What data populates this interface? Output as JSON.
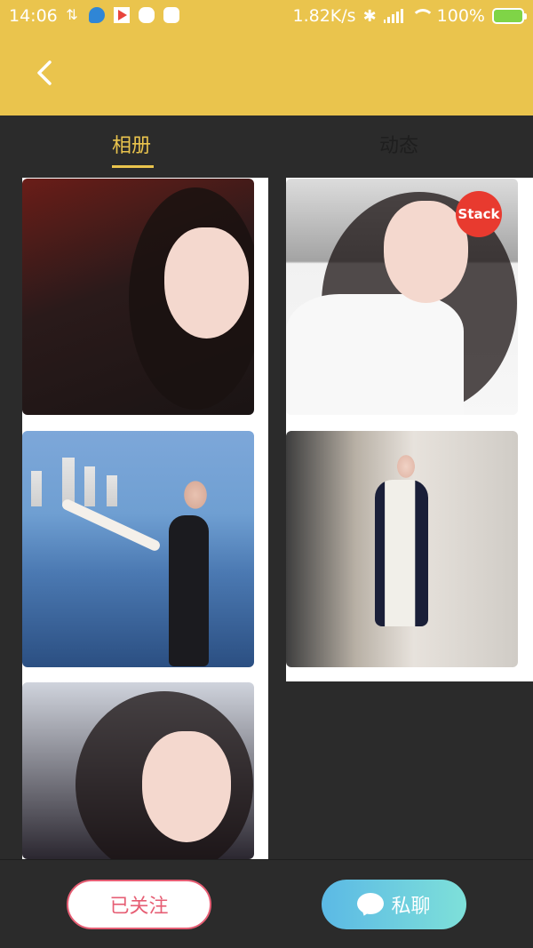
{
  "status_bar": {
    "time": "14:06",
    "speed": "1.82K/s",
    "battery": "100%"
  },
  "header": {
    "back_icon": "chevron-left-icon"
  },
  "tabs": [
    {
      "label": "相册",
      "active": true
    },
    {
      "label": "动态",
      "active": false
    }
  ],
  "photos": [
    {
      "name": "photo-1"
    },
    {
      "name": "photo-2",
      "badge": "Stack"
    },
    {
      "name": "photo-3"
    },
    {
      "name": "photo-4"
    },
    {
      "name": "photo-5"
    }
  ],
  "bottom_bar": {
    "follow_label": "已关注",
    "chat_label": "私聊"
  },
  "colors": {
    "accent": "#eac44d",
    "follow": "#e65e74",
    "badge": "#e83a2f",
    "chat_gradient_start": "#5bb9e5",
    "chat_gradient_end": "#7ee0d9"
  }
}
